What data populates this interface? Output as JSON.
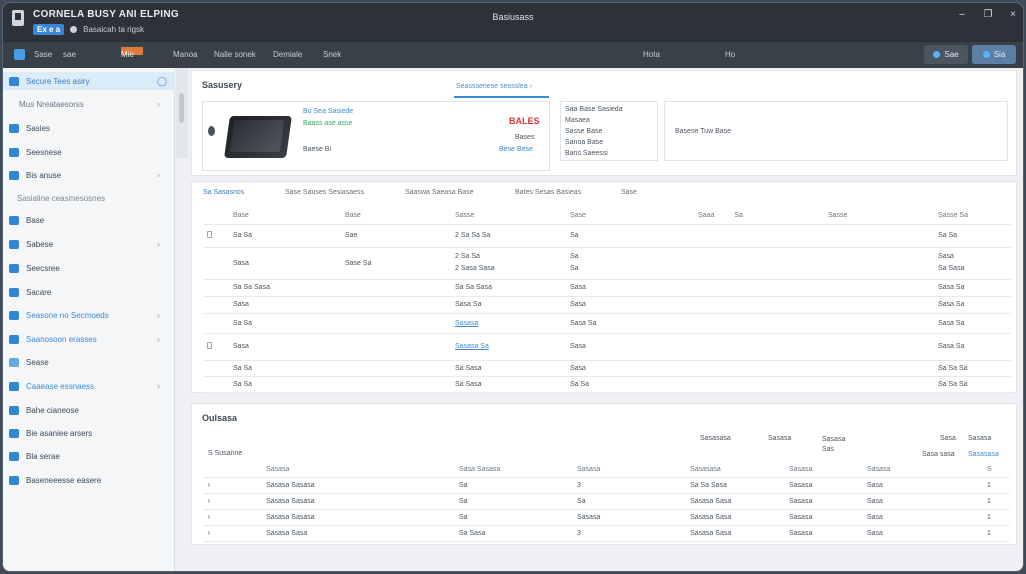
{
  "titlebar": {
    "app_title": "CORNELA BUSY ANI ELPING",
    "sub_chip": "Ex e a",
    "sub_text": "Basaicah ta rigsk",
    "window_title": "Basiusass",
    "controls": [
      "–",
      "❐",
      "×"
    ]
  },
  "toolbar": {
    "items": [
      "Sase",
      "sae",
      "Mie",
      "Manoa",
      "Nalle sonek",
      "Demiale",
      "Snek"
    ],
    "right_items": [
      "Hota",
      "Ho"
    ],
    "btn1_label": "Sae",
    "btn2_label": "Sia"
  },
  "sidebar": {
    "items": [
      {
        "label": "Secure Tees asiry",
        "chev": "◯"
      },
      {
        "label": "Mus Nreataesorss",
        "chev": "›"
      },
      {
        "label": "Sasies",
        "chev": ""
      },
      {
        "label": "Seesnese",
        "chev": ""
      },
      {
        "label": "Bis anuse",
        "chev": "›"
      },
      {
        "label": "Sasialine ceasmesosnes",
        "chev": ""
      },
      {
        "label": "Base",
        "chev": ""
      },
      {
        "label": "Sabese",
        "chev": "›"
      },
      {
        "label": "Seecsree",
        "chev": ""
      },
      {
        "label": "Sacare",
        "chev": ""
      },
      {
        "label": "Seasone no Secmoeds",
        "chev": "›"
      },
      {
        "label": "Saanosoon erasses",
        "chev": "›"
      },
      {
        "label": "Sease",
        "chev": ""
      },
      {
        "label": "Caaease essnaess",
        "chev": "›"
      },
      {
        "label": "Bahe cianeose",
        "chev": ""
      },
      {
        "label": "Bie asaniee arsers",
        "chev": ""
      },
      {
        "label": "Bla serae",
        "chev": ""
      },
      {
        "label": "Baseneeesse easere",
        "chev": ""
      }
    ]
  },
  "summary": {
    "heading": "Sasusery",
    "tab": "Seasssenese seosslea",
    "tab_arrow": "›",
    "product_line1": "Bu Sea Sasiede",
    "product_line2": "Baass ase asse",
    "product_line3": "Baese Bi",
    "price": "BALES",
    "price_note1": "Bases",
    "price_note2": "Bese Bese",
    "details": [
      "Saa Base Sasieda",
      "Masaea",
      "Sasse Base",
      "Sanoa Base",
      "Bans Saeessi"
    ],
    "box_text": "Basese  Tuw Base"
  },
  "filters": [
    {
      "label": "Sa Sasasnos",
      "selected": true
    },
    {
      "label": "Sase  Sauses Sesiasaess",
      "selected": false
    },
    {
      "label": "Saaswa Saeasa Base",
      "selected": false
    },
    {
      "label": "Bates Sesas Basieas",
      "selected": false
    },
    {
      "label": "Sase",
      "selected": false
    }
  ],
  "main_table": {
    "headers": [
      "Base",
      "Base",
      "Sasse",
      "Sase",
      "Saaa",
      "Sasse",
      "Sasse"
    ],
    "extra_headers": [
      "Sa",
      "Sa"
    ],
    "rows": [
      {
        "check": true,
        "c1": "Sa Sa",
        "c2": "Sae",
        "c3": "2 Sa Sa Sa",
        "c4": "Sa",
        "c5": "",
        "c6": "",
        "c7": "Sa Sa"
      },
      {
        "check": false,
        "c1": "Sasa",
        "c2": "Sase  Sa",
        "c3": "2 Sa Sa\n2 Sasa Sasa",
        "c4": "Sa\nSa",
        "c5": "",
        "c6": "",
        "c7": "Sasa\nSa Sasa"
      },
      {
        "check": false,
        "c1": "Sa Sa Sasa",
        "c2": "",
        "c3": "Sa Sa Sasa",
        "c4": "Sasa",
        "c5": "",
        "c6": "",
        "c7": "Sasa Sa"
      },
      {
        "check": false,
        "c1": "Sasa",
        "c2": "",
        "c3": "Sasa Sa",
        "c4": "Sasa",
        "c5": "",
        "c6": "",
        "c7": "Sasa Sa"
      },
      {
        "check": false,
        "c1": "Sa Sa",
        "c2": "",
        "c3": "Sasasa",
        "c4": "Sasa Sa",
        "c5": "",
        "c6": "",
        "c7": "Sasa Sa"
      },
      {
        "check": true,
        "c1": "Sasa",
        "c2": "",
        "c3": "Sasasa Sa",
        "c4": "Sasa",
        "c5": "",
        "c6": "",
        "c7": "Sasa Sa"
      },
      {
        "check": false,
        "c1": "Sa Sa",
        "c2": "",
        "c3": "Sa Sasa",
        "c4": "Sasa",
        "c5": "",
        "c6": "",
        "c7": "Sa Sa Sa"
      },
      {
        "check": false,
        "c1": "Sa Sa",
        "c2": "",
        "c3": "Sa Sasa",
        "c4": "Sa Sa",
        "c5": "",
        "c6": "",
        "c7": "Sa Sa Sa"
      }
    ],
    "link_row_indices": [
      4,
      5
    ]
  },
  "outstanding": {
    "heading": "Oulsasa",
    "subheading": "S Susanne",
    "top_headers": [
      "Sasasasa",
      "Sasasa",
      "Sasasa\nSas",
      "Sasa",
      "Sasasa"
    ],
    "top_headers_right": [
      "Sasa sasa",
      "Sasasasa"
    ],
    "col_headers": [
      "Sasasa",
      "Sasa Sasasa",
      "Sasasa",
      "Sasasasa",
      "Sasasa",
      "Sasasa",
      "S"
    ],
    "rows": [
      [
        "Sasasa Sasasa",
        "Sa",
        "3",
        "Sa Sa Sasa",
        "Sasasa",
        "Sasa",
        "1"
      ],
      [
        "Sasasa Sasasa",
        "Sa",
        "Sa",
        "Sasasa Sasa",
        "Sasasa",
        "Sasa",
        "1"
      ],
      [
        "Sasasa Sasasa",
        "Sa",
        "Sasasa",
        "Sasasa Sasa",
        "Sasasa",
        "Sasa",
        "1"
      ],
      [
        "Sasasa Sasa",
        "Sa Sasa",
        "3",
        "Sasasa Sasa",
        "Sasasa",
        "Sasa",
        "1"
      ]
    ]
  },
  "colors": {
    "accent": "#3b8ad6",
    "titlebar": "#2d3238",
    "price_red": "#d93a3a",
    "green": "#3aa466",
    "toolbar_accent": "#e07a3a"
  }
}
